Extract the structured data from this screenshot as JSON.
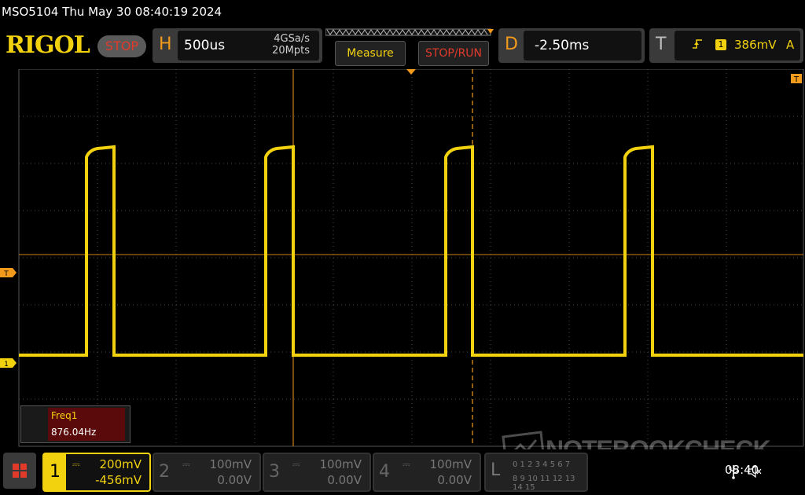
{
  "window_title": "MSO5104  Thu May 30 08:40:19 2024",
  "brand": "RIGOL",
  "run_state": "STOP",
  "horizontal": {
    "letter": "H",
    "timebase": "500us",
    "sample_rate": "4GSa/s",
    "memory_depth": "20Mpts"
  },
  "buttons": {
    "measure": "Measure",
    "stop_run": "STOP/RUN"
  },
  "delay": {
    "letter": "D",
    "value": "-2.50ms"
  },
  "trigger": {
    "letter": "T",
    "channel": "1",
    "level": "386mV",
    "mode": "A"
  },
  "markers": {
    "trigger_right": "T",
    "trigger_left": "T",
    "channel_1": "1"
  },
  "measurement": {
    "label": "Freq1",
    "value": "876.04Hz"
  },
  "channels": [
    {
      "num": "1",
      "scale": "200mV",
      "offset": "-456mV",
      "active": true
    },
    {
      "num": "2",
      "scale": "100mV",
      "offset": "0.00V",
      "active": false
    },
    {
      "num": "3",
      "scale": "100mV",
      "offset": "0.00V",
      "active": false
    },
    {
      "num": "4",
      "scale": "100mV",
      "offset": "0.00V",
      "active": false
    }
  ],
  "logic": {
    "letter": "L",
    "row1": "0 1 2 3 4 5 6 7",
    "row2": "8 9 10 11 12 13 14 15"
  },
  "watermark": "NOTEBOOKCHECK",
  "clock": "08:40",
  "colors": {
    "ch1": "#f2d20f",
    "trigger": "#f29a1c",
    "grid": "#5a5a5a"
  }
}
